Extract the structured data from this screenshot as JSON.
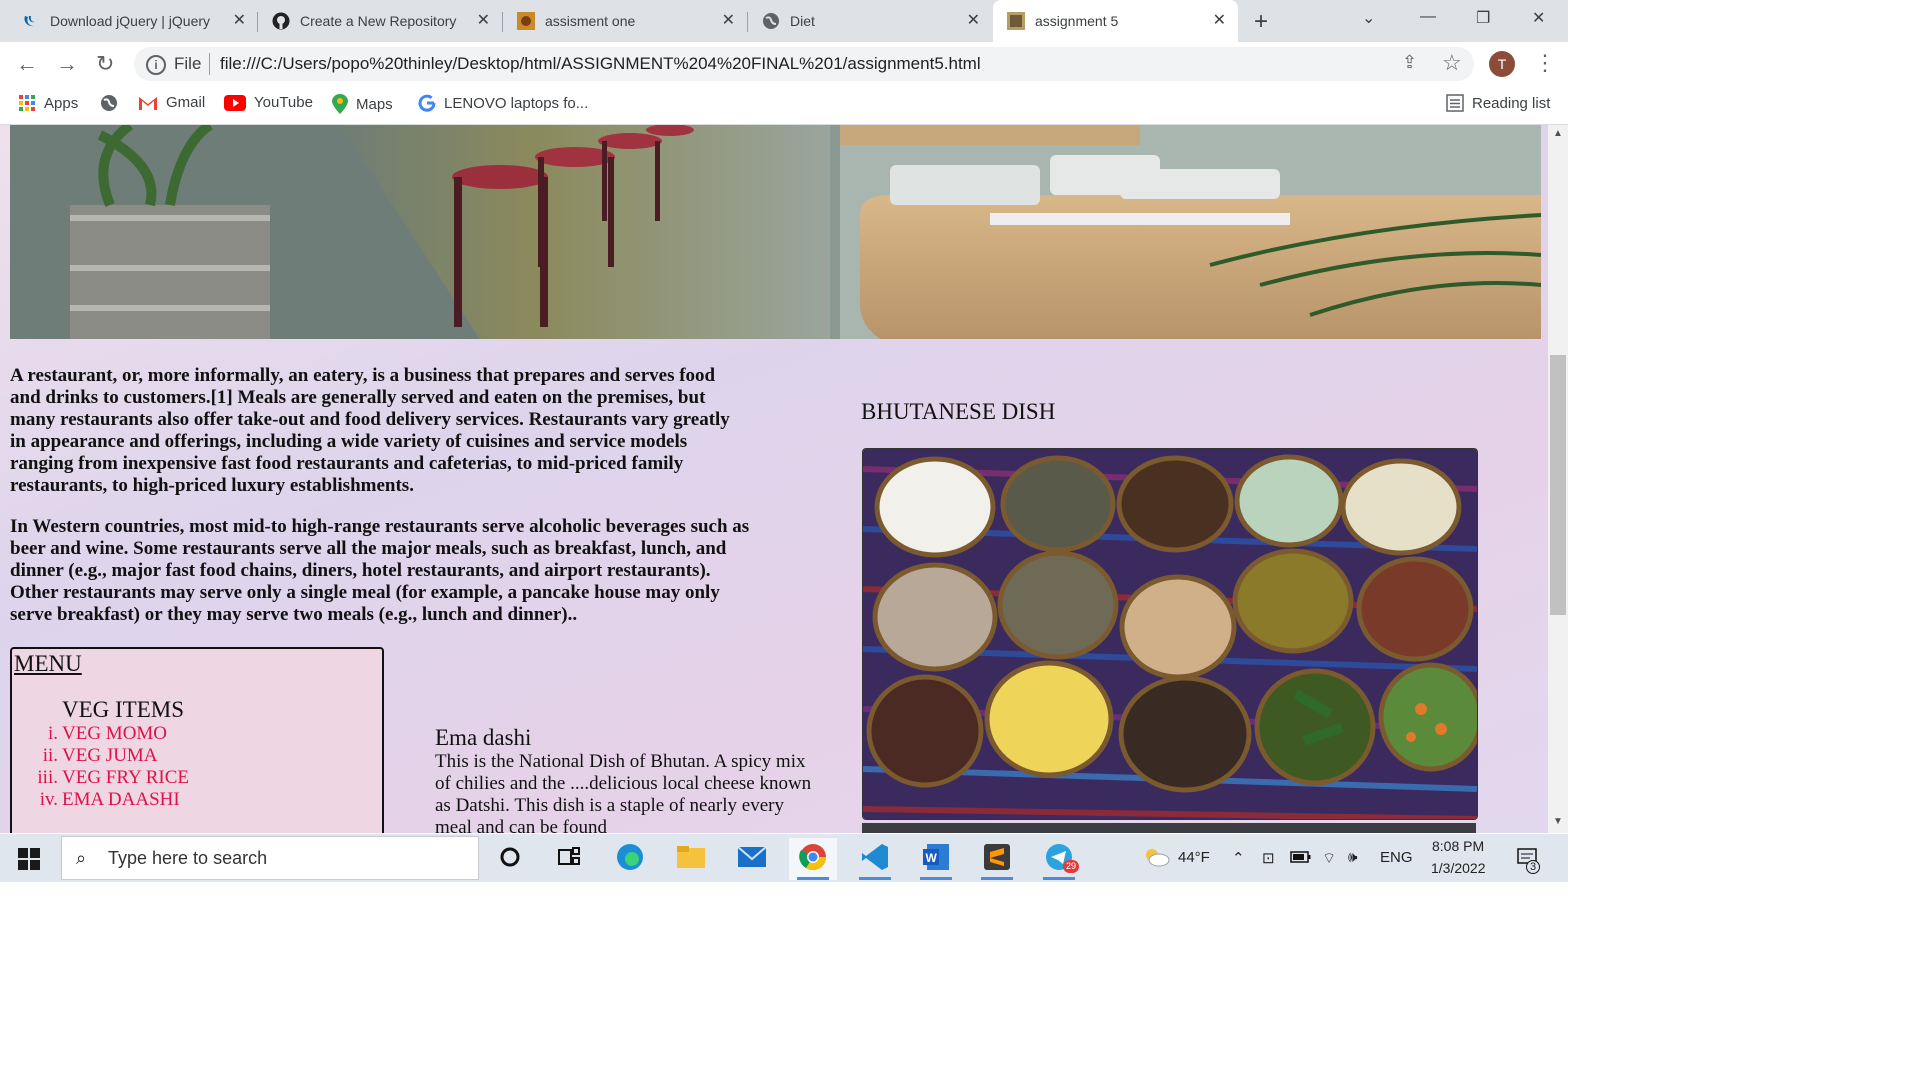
{
  "browser": {
    "tabs": [
      {
        "title": "Download jQuery | jQuery",
        "icon": "jquery-icon"
      },
      {
        "title": "Create a New Repository",
        "icon": "github-icon"
      },
      {
        "title": "assisment one",
        "icon": "image-thumbnail-icon"
      },
      {
        "title": "Diet",
        "icon": "globe-icon"
      },
      {
        "title": "assignment 5",
        "icon": "image-thumbnail-icon",
        "active": true
      }
    ],
    "close_glyph": "✕",
    "new_tab_glyph": "+",
    "address": {
      "scheme_label": "File",
      "url": "file:///C:/Users/popo%20thinley/Desktop/html/ASSIGNMENT%204%20FINAL%201/assignment5.html"
    },
    "profile_initial": "T",
    "bookmarks": [
      {
        "label": "Apps",
        "icon": "apps-grid-icon"
      },
      {
        "label": "",
        "icon": "globe-icon"
      },
      {
        "label": "Gmail",
        "icon": "gmail-icon"
      },
      {
        "label": "YouTube",
        "icon": "youtube-icon"
      },
      {
        "label": "Maps",
        "icon": "maps-pin-icon"
      },
      {
        "label": "LENOVO laptops fo...",
        "icon": "google-icon"
      }
    ],
    "reading_list": "Reading list"
  },
  "page": {
    "paragraph1": "A restaurant, or, more informally, an eatery, is a business that prepares and serves food and drinks to customers.[1] Meals are generally served and eaten on the premises, but many restaurants also offer take-out and food delivery services. Restaurants vary greatly in appearance and offerings, including a wide variety of cuisines and service models ranging from inexpensive fast food restaurants and cafeterias, to mid-priced family restaurants, to high-priced luxury establishments.",
    "paragraph2": "In Western countries, most mid-to high-range restaurants serve alcoholic beverages such as beer and wine. Some restaurants serve all the major meals, such as breakfast, lunch, and dinner (e.g., major fast food chains, diners, hotel restaurants, and airport restaurants). Other restaurants may serve only a single meal (for example, a pancake house may only serve breakfast) or they may serve two meals (e.g., lunch and dinner)..",
    "menu": {
      "title": "MENU",
      "veg_title": "VEG ITEMS",
      "items": [
        {
          "num": "i.",
          "label": "VEG MOMO"
        },
        {
          "num": "ii.",
          "label": "VEG JUMA"
        },
        {
          "num": "iii.",
          "label": "VEG FRY RICE"
        },
        {
          "num": "iv.",
          "label": "EMA DAASHI"
        }
      ]
    },
    "ema": {
      "title": "Ema dashi",
      "description": "This is the National Dish of Bhutan. A spicy mix of chilies and the ....delicious local cheese known as Datshi. This dish is a staple of nearly every meal and can be found"
    },
    "dish_title": "BHUTANESE DISH",
    "colors": {
      "menu_item": "#e0104a",
      "page_bg": "#e2d8ee"
    }
  },
  "taskbar": {
    "search_placeholder": "Type here to search",
    "weather": "44°F",
    "language": "ENG",
    "time": "8:08 PM",
    "date": "1/3/2022",
    "telegram_badge": "29",
    "notification_count": "3"
  }
}
